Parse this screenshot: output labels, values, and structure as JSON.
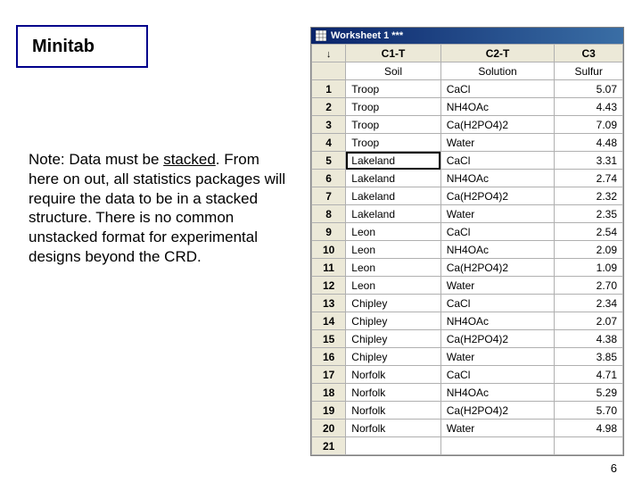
{
  "title": "Minitab",
  "note": {
    "lead": "Note: Data must be ",
    "underlined": "stacked",
    "rest": ". From here on out, all statistics packages will require the data to be in a stacked structure. There is no common unstacked format for experimental designs beyond the CRD."
  },
  "page_number": "6",
  "worksheet": {
    "title": "Worksheet 1 ***",
    "name_row_icon": "↓",
    "col_headers": [
      "C1-T",
      "C2-T",
      "C3"
    ],
    "col_names": [
      "Soil",
      "Solution",
      "Sulfur"
    ],
    "selected": {
      "row": 5,
      "col": 1
    },
    "rows": [
      {
        "n": "1",
        "c1": "Troop",
        "c2": "CaCl",
        "c3": "5.07"
      },
      {
        "n": "2",
        "c1": "Troop",
        "c2": "NH4OAc",
        "c3": "4.43"
      },
      {
        "n": "3",
        "c1": "Troop",
        "c2": "Ca(H2PO4)2",
        "c3": "7.09"
      },
      {
        "n": "4",
        "c1": "Troop",
        "c2": "Water",
        "c3": "4.48"
      },
      {
        "n": "5",
        "c1": "Lakeland",
        "c2": "CaCl",
        "c3": "3.31"
      },
      {
        "n": "6",
        "c1": "Lakeland",
        "c2": "NH4OAc",
        "c3": "2.74"
      },
      {
        "n": "7",
        "c1": "Lakeland",
        "c2": "Ca(H2PO4)2",
        "c3": "2.32"
      },
      {
        "n": "8",
        "c1": "Lakeland",
        "c2": "Water",
        "c3": "2.35"
      },
      {
        "n": "9",
        "c1": "Leon",
        "c2": "CaCl",
        "c3": "2.54"
      },
      {
        "n": "10",
        "c1": "Leon",
        "c2": "NH4OAc",
        "c3": "2.09"
      },
      {
        "n": "11",
        "c1": "Leon",
        "c2": "Ca(H2PO4)2",
        "c3": "1.09"
      },
      {
        "n": "12",
        "c1": "Leon",
        "c2": "Water",
        "c3": "2.70"
      },
      {
        "n": "13",
        "c1": "Chipley",
        "c2": "CaCl",
        "c3": "2.34"
      },
      {
        "n": "14",
        "c1": "Chipley",
        "c2": "NH4OAc",
        "c3": "2.07"
      },
      {
        "n": "15",
        "c1": "Chipley",
        "c2": "Ca(H2PO4)2",
        "c3": "4.38"
      },
      {
        "n": "16",
        "c1": "Chipley",
        "c2": "Water",
        "c3": "3.85"
      },
      {
        "n": "17",
        "c1": "Norfolk",
        "c2": "CaCl",
        "c3": "4.71"
      },
      {
        "n": "18",
        "c1": "Norfolk",
        "c2": "NH4OAc",
        "c3": "5.29"
      },
      {
        "n": "19",
        "c1": "Norfolk",
        "c2": "Ca(H2PO4)2",
        "c3": "5.70"
      },
      {
        "n": "20",
        "c1": "Norfolk",
        "c2": "Water",
        "c3": "4.98"
      },
      {
        "n": "21",
        "c1": "",
        "c2": "",
        "c3": ""
      }
    ]
  }
}
